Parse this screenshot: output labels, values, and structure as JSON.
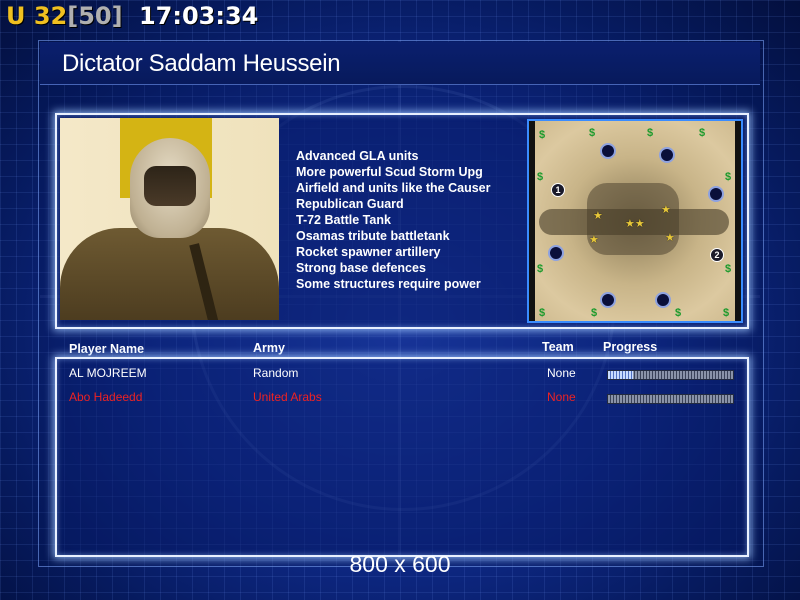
{
  "hud": {
    "prefix": "U",
    "count": "32",
    "max": "[50]",
    "clock": "17:03:34"
  },
  "general": {
    "title": "Dictator Saddam Heussein",
    "features": [
      "Advanced GLA units",
      "More powerful Scud Storm Upg",
      "Airfield and units like the Causer",
      "Republican Guard",
      "T-72 Battle Tank",
      "Osamas tribute battletank",
      "Rocket spawner artillery",
      "Strong base defences",
      "Some structures require power"
    ]
  },
  "minimap": {
    "start_labels": [
      "1",
      "2"
    ]
  },
  "players": {
    "headers": {
      "name": "Player Name",
      "army": "Army",
      "team": "Team",
      "progress": "Progress"
    },
    "rows": [
      {
        "name": "AL MOJREEM",
        "army": "Random",
        "team": "None",
        "progress": 0.2,
        "color": "#ffffff"
      },
      {
        "name": "Abo Hadeedd",
        "army": "United Arabs",
        "team": "None",
        "progress": 0.0,
        "color": "#ee2222"
      }
    ]
  },
  "footer": {
    "resolution": "800 x 600"
  },
  "colors": {
    "accent_yellow": "#f0c020",
    "panel_border": "#e8f0ff",
    "minimap_border": "#3a8cff",
    "player_red": "#ee2222"
  }
}
